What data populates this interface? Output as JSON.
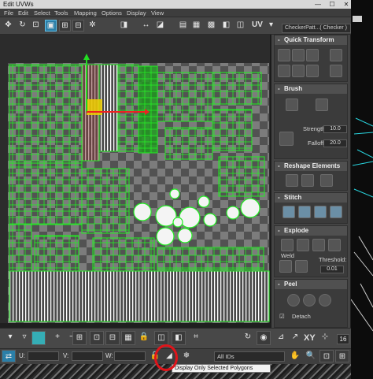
{
  "window": {
    "title": "Edit UVWs",
    "controls": [
      "—",
      "☐",
      "✕"
    ]
  },
  "menu": [
    "File",
    "Edit",
    "Select",
    "Tools",
    "Mapping",
    "Options",
    "Display",
    "View"
  ],
  "toolbar": {
    "uv_label": "UV",
    "checker_pattern": "CheckerPatt...( Checker )"
  },
  "panel": {
    "quick_transform": {
      "title": "Quick Transform"
    },
    "brush": {
      "title": "Brush",
      "strength_label": "Strength:",
      "strength_value": "10.0",
      "falloff_label": "Falloff:",
      "falloff_value": "20.0"
    },
    "reshape": {
      "title": "Reshape Elements"
    },
    "stitch": {
      "title": "Stitch"
    },
    "explode": {
      "title": "Explode",
      "weld_label": "Weld",
      "threshold_label": "Threshold:",
      "threshold_value": "0.01"
    },
    "peel": {
      "title": "Peel",
      "detach_label": "Detach"
    }
  },
  "bottom": {
    "u_label": "U:",
    "v_label": "V:",
    "w_label": "W:",
    "xy_label": "XY",
    "grid_value": "16",
    "ids_dropdown": "All IDs"
  },
  "tooltip": "Display Only Selected Polygons",
  "colors": {
    "accent": "#2b7fa8",
    "uv_edge": "#22ee22",
    "gizmo_red": "#ff2222",
    "highlight": "#e0141a"
  }
}
